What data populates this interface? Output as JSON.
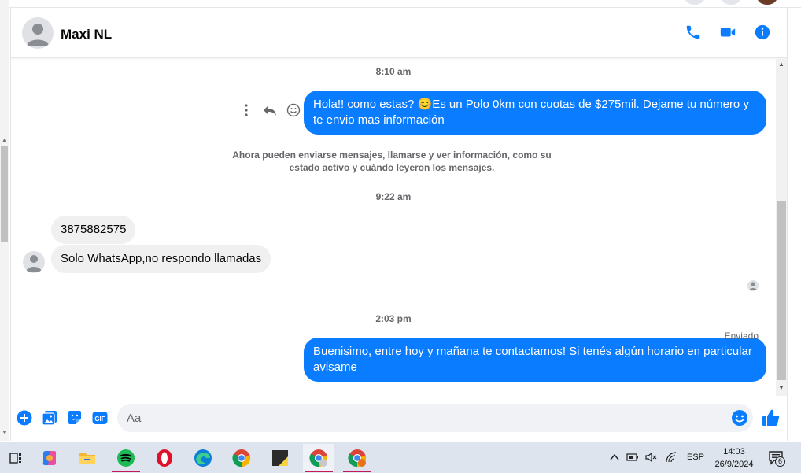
{
  "header": {
    "contact_name": "Maxi NL",
    "icons": [
      "phone-icon",
      "video-icon",
      "info-icon"
    ]
  },
  "messages": [
    {
      "type": "timestamp",
      "text": "8:10 am"
    },
    {
      "type": "outgoing",
      "text": "Hola!! como estas? 😊Es un Polo 0km con cuotas de $275mil. Dejame tu número y te envio mas información"
    },
    {
      "type": "system",
      "text": "Ahora pueden enviarse mensajes, llamarse y ver información, como su estado activo y cuándo leyeron los mensajes."
    },
    {
      "type": "timestamp",
      "text": "9:22 am"
    },
    {
      "type": "incoming",
      "text": "3875882575"
    },
    {
      "type": "incoming",
      "text": "Solo WhatsApp,no respondo llamadas"
    },
    {
      "type": "timestamp",
      "text": "2:03 pm"
    },
    {
      "type": "outgoing",
      "text": "Buenisimo, entre hoy y mañana te contactamos! Si tenés algún horario en particular avisame"
    }
  ],
  "status": {
    "sent_label": "Enviado"
  },
  "composer": {
    "placeholder": "Aa"
  },
  "taskbar": {
    "apps": [
      "task-view",
      "copilot",
      "file-explorer",
      "spotify",
      "opera",
      "edge",
      "chrome",
      "sticky-notes",
      "chrome-profile-1",
      "chrome-profile-2"
    ],
    "language": "ESP",
    "time": "14:03",
    "date": "26/9/2024",
    "notification_count": "6"
  },
  "colors": {
    "accent": "#0a7cff",
    "incoming_bubble": "#f0f0f0",
    "taskbar": "#dee4ee"
  }
}
